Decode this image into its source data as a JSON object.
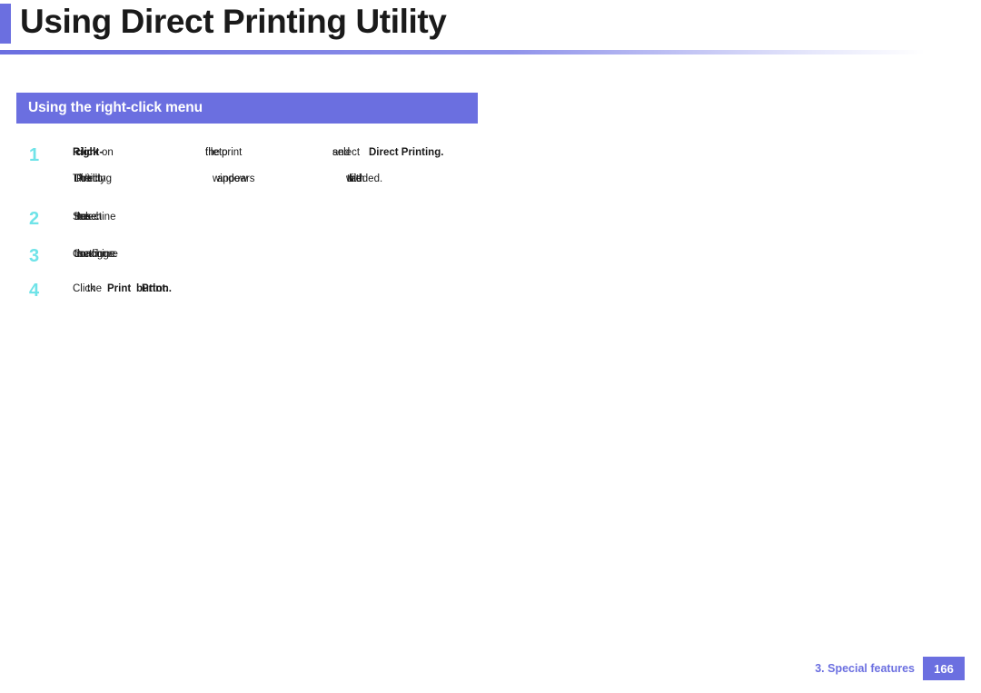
{
  "header": {
    "title": "Using Direct Printing Utility"
  },
  "section": {
    "title": "Using the right-click menu"
  },
  "steps": [
    {
      "number": "1",
      "line1_a": "Right-",
      "line1_b": "click",
      "line1_c": "on",
      "line1_d": "the",
      "line1_e": "file",
      "line1_f": "to",
      "line1_g": "print",
      "line1_h": "and",
      "line1_i": "select",
      "line1_j": "Direct Printing.",
      "line2_a": "The",
      "line2_b": "Direct",
      "line2_c": "Printing",
      "line2_d": "Utility",
      "line2_e": "window",
      "line2_f": "appears",
      "line2_g": "with",
      "line2_h": "the",
      "line2_i": "file",
      "line2_j": "added.",
      "line2_k": "Utility"
    },
    {
      "number": "2",
      "text_a": "Select",
      "text_b": "the",
      "text_c": "machine",
      "text_d": "to",
      "text_e": "use."
    },
    {
      "number": "3",
      "text_a": "Configure",
      "text_b": "the",
      "text_c": "machine",
      "text_d": "settings."
    },
    {
      "number": "4",
      "text_a": "Click",
      "text_b": "the",
      "text_c": "Print",
      "text_d": "button.",
      "text_e": "Print."
    }
  ],
  "footer": {
    "chapter": "3.  Special features",
    "page": "166"
  }
}
